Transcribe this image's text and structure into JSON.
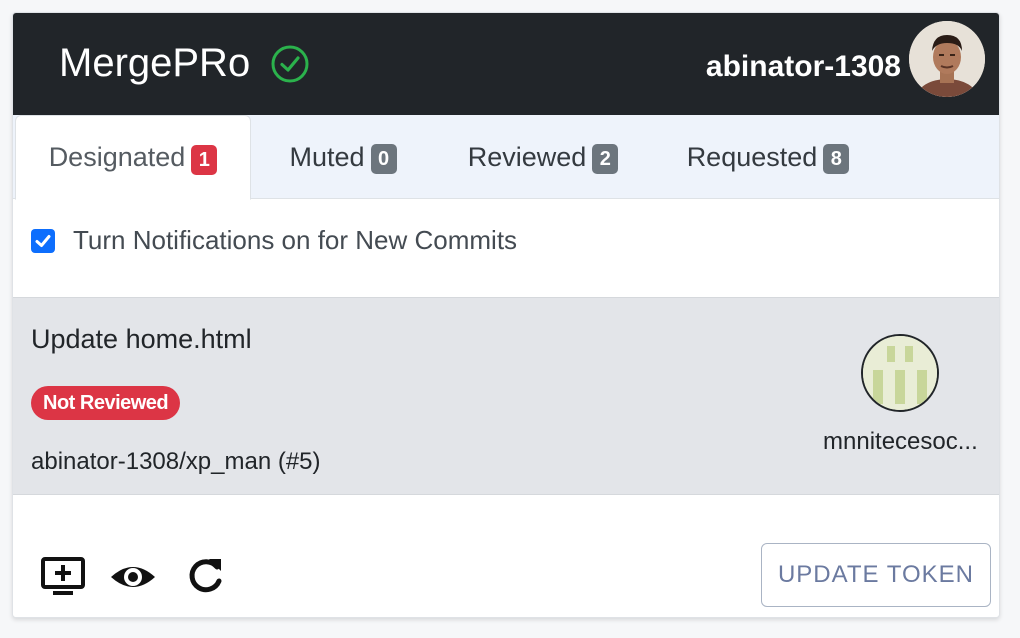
{
  "app": {
    "title": "MergePRo",
    "username": "abinator-1308"
  },
  "tabs": [
    {
      "label": "Designated",
      "count": "1",
      "badge_color": "#dc3545"
    },
    {
      "label": "Muted",
      "count": "0",
      "badge_color": "#6c757d"
    },
    {
      "label": "Reviewed",
      "count": "2",
      "badge_color": "#6c757d"
    },
    {
      "label": "Requested",
      "count": "8",
      "badge_color": "#6c757d"
    }
  ],
  "notifications": {
    "label": "Turn Notifications on for New Commits",
    "checked": true
  },
  "pull_request": {
    "title": "Update home.html",
    "status": "Not Reviewed",
    "repo": "abinator-1308/xp_man (#5)",
    "author": "mnnitecesoc..."
  },
  "footer": {
    "icons": [
      "add-to-queue-icon",
      "eye-icon",
      "refresh-icon"
    ],
    "update_button": "UPDATE TOKEN"
  },
  "colors": {
    "header_bg": "#212529",
    "accent_green": "#2bb24c",
    "danger": "#dc3545",
    "badge_gray": "#6c757d",
    "checkbox_blue": "#0d6efd"
  }
}
